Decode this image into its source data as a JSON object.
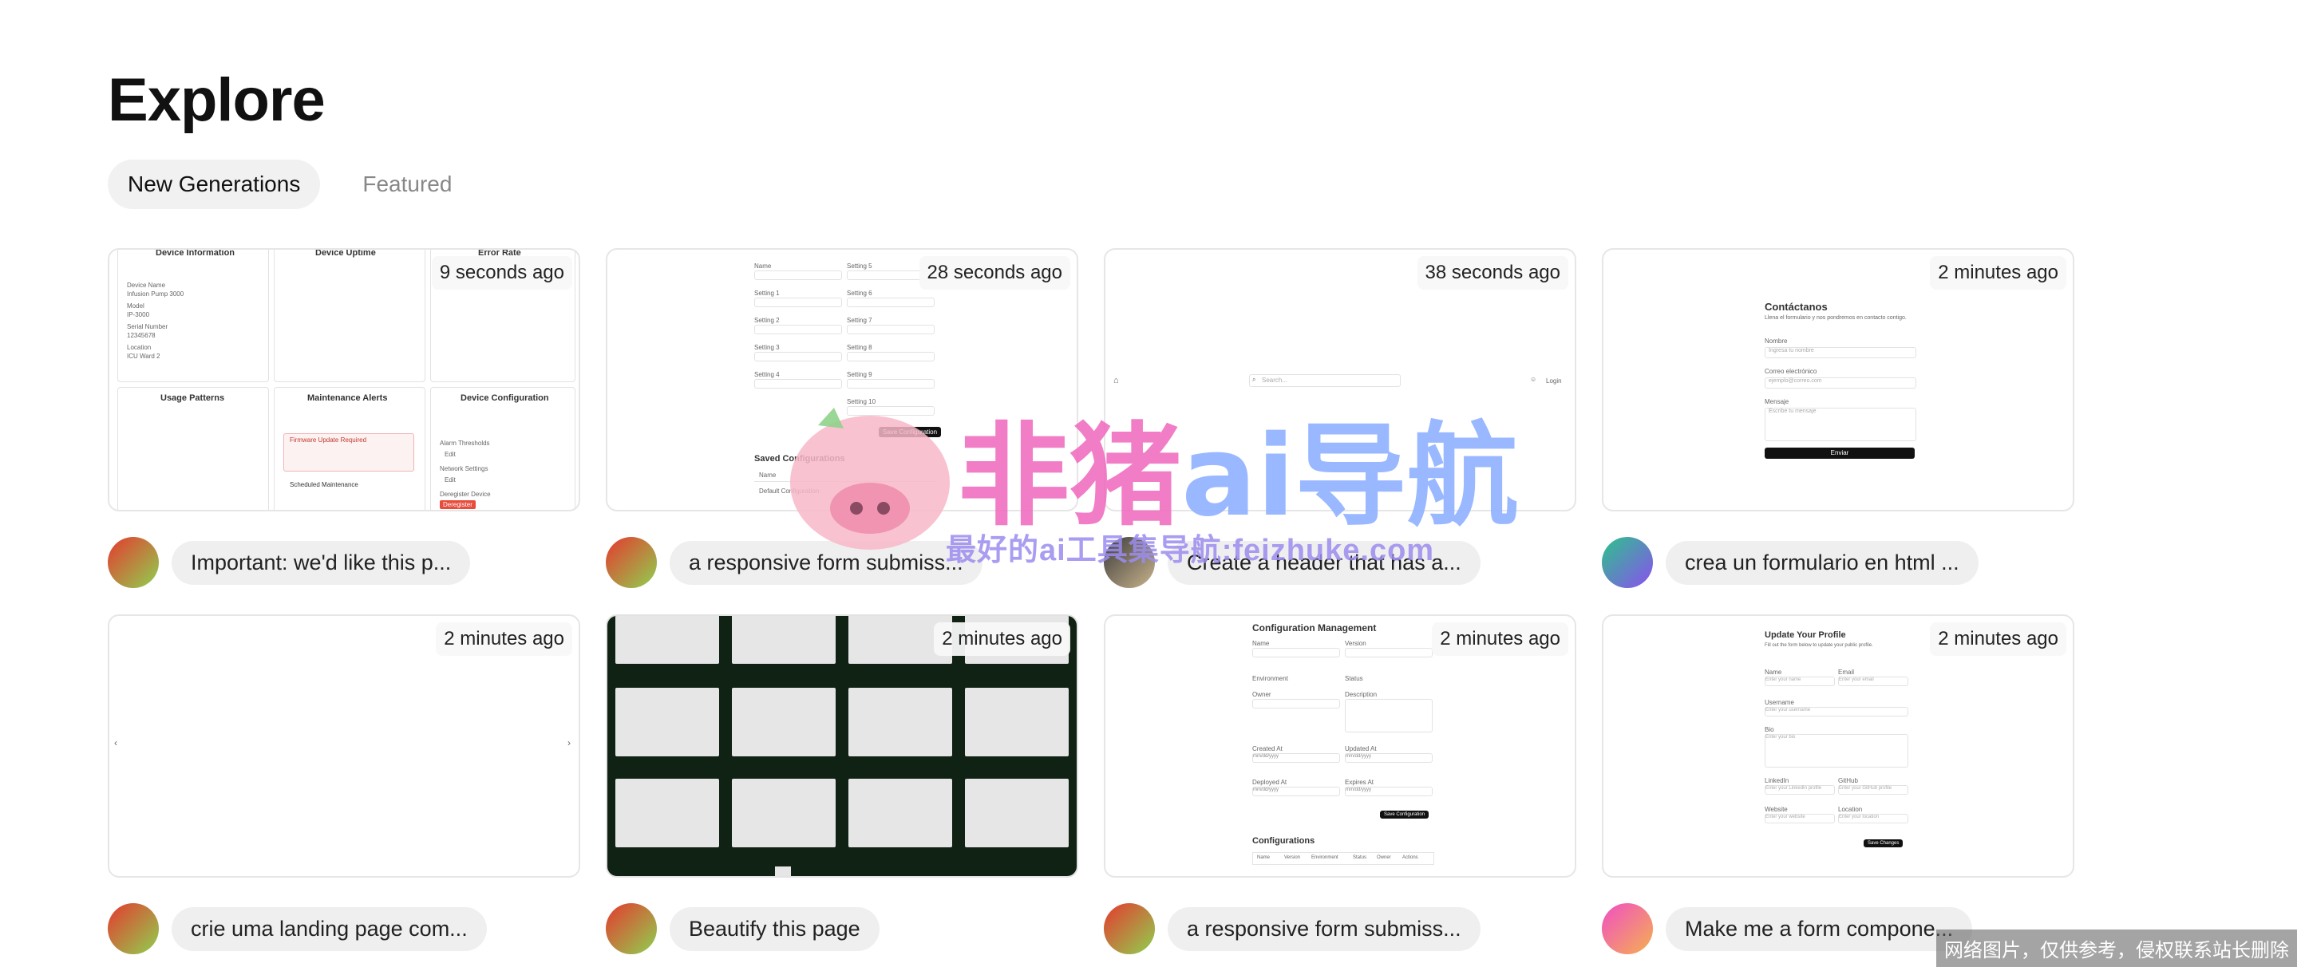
{
  "page": {
    "title": "Explore"
  },
  "tabs": [
    {
      "label": "New Generations",
      "active": true
    },
    {
      "label": "Featured",
      "active": false
    }
  ],
  "cards": [
    {
      "time": "9 seconds ago",
      "prompt": "Important: we'd like this p...",
      "avatar_colors": [
        "#e5392f",
        "#8fd14f"
      ],
      "thumb": {
        "panels": [
          "Device Information",
          "Device Uptime",
          "Error Rate",
          "Usage Patterns",
          "Maintenance Alerts",
          "Device Configuration"
        ],
        "fields": [
          "Device Name",
          "Infusion Pump 3000",
          "Model",
          "IP-3000",
          "Serial Number",
          "12345678",
          "Location",
          "ICU Ward 2"
        ],
        "alert_title": "Firmware Update Required",
        "alert2_title": "Scheduled Maintenance",
        "config_fields": [
          "Alarm Thresholds",
          "Network Settings",
          "Deregister Device"
        ],
        "edit_label": "Edit",
        "action_label": "Deregister"
      }
    },
    {
      "time": "28 seconds ago",
      "prompt": "a responsive form submiss...",
      "avatar_colors": [
        "#e5392f",
        "#8fd14f"
      ],
      "thumb": {
        "left_fields": [
          "Name",
          "Setting 1",
          "Setting 2",
          "Setting 3",
          "Setting 4"
        ],
        "right_fields": [
          "Setting 5",
          "Setting 6",
          "Setting 7",
          "Setting 8",
          "Setting 9",
          "Setting 10"
        ],
        "save_label": "Save Configuration",
        "section_title": "Saved Configurations",
        "row_labels": [
          "Name",
          "Default Configuration"
        ]
      }
    },
    {
      "time": "38 seconds ago",
      "prompt": "Create a header that has a...",
      "avatar_colors": [
        "#3b3b3b",
        "#c9b48c"
      ],
      "thumb": {
        "search_placeholder": "Search...",
        "login_label": "Login"
      }
    },
    {
      "time": "2 minutes ago",
      "prompt": "crea un formulario en html ...",
      "avatar_colors": [
        "#2bc48a",
        "#8b4ff0"
      ],
      "thumb": {
        "title": "Contáctanos",
        "subtitle": "Llena el formulario y nos pondremos en contacto contigo.",
        "fields": [
          "Nombre",
          "Correo electrónico",
          "Mensaje"
        ],
        "placeholders": [
          "Ingresa tu nombre",
          "ejemplo@correo.com",
          "Escribe tu mensaje"
        ],
        "button": "Enviar"
      }
    },
    {
      "time": "2 minutes ago",
      "prompt": "crie uma landing page com...",
      "avatar_colors": [
        "#e5392f",
        "#8fd14f"
      ],
      "thumb": {
        "prev": "‹",
        "next": "›"
      }
    },
    {
      "time": "2 minutes ago",
      "prompt": "Beautify this page",
      "avatar_colors": [
        "#e5392f",
        "#8fd14f"
      ],
      "thumb": {
        "captions": [
          "",
          "",
          "",
          "",
          "",
          "",
          "",
          "",
          "",
          "",
          "",
          "",
          ""
        ],
        "bottom_caption": ""
      }
    },
    {
      "time": "2 minutes ago",
      "prompt": "a responsive form submiss...",
      "avatar_colors": [
        "#e5392f",
        "#8fd14f"
      ],
      "thumb": {
        "title": "Configuration Management",
        "fields": [
          "Name",
          "Version",
          "Environment",
          "Status",
          "Owner",
          "Description",
          "Created At",
          "Updated At",
          "Deployed At",
          "Expires At"
        ],
        "date_placeholder": "mm/dd/yyyy",
        "save_label": "Save Configuration",
        "section_title": "Configurations",
        "columns": [
          "Name",
          "Version",
          "Environment",
          "Status",
          "Owner",
          "Actions"
        ]
      }
    },
    {
      "time": "2 minutes ago",
      "prompt": "Make me a form compone...",
      "avatar_colors": [
        "#f04fc4",
        "#f5b04f"
      ],
      "thumb": {
        "title": "Update Your Profile",
        "subtitle": "Fill out the form below to update your public profile.",
        "fields": [
          "Name",
          "Email",
          "Username",
          "Bio",
          "LinkedIn",
          "GitHub",
          "Website",
          "Location"
        ],
        "placeholders": [
          "Enter your name",
          "Enter your email",
          "Enter your username",
          "Enter your bio",
          "Enter your LinkedIn profile",
          "Enter your GitHub profile",
          "Enter your website",
          "Enter your location"
        ],
        "button": "Save Changes"
      }
    }
  ],
  "watermark": {
    "title": "非猪ai导航",
    "tagline": "最好的ai工具集导航:feizhuke.com",
    "title_colors": [
      "#f06fc0",
      "#8fb1ff"
    ]
  },
  "copyright_note": "网络图片，仅供参考，侵权联系站长删除"
}
